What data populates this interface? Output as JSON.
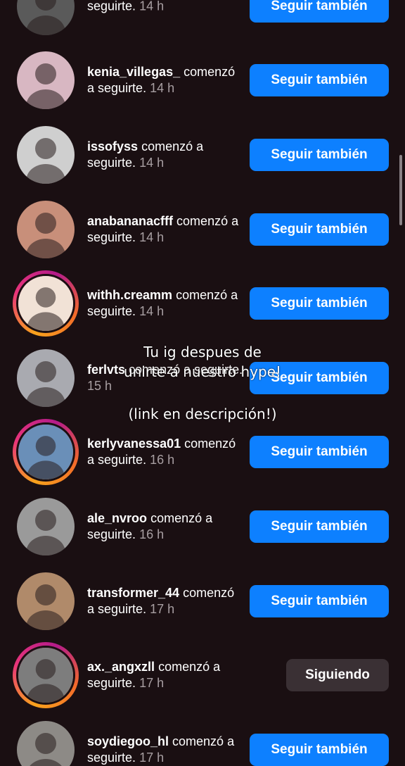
{
  "followers": [
    {
      "username": "",
      "action_line1": "",
      "action_line2": "seguirte.",
      "time": "14 h",
      "button": "Seguir también",
      "following": false,
      "ring": false,
      "avatar_color": "#5a5a5a"
    },
    {
      "username": "kenia_villegas_",
      "action_line1": "comenzó a",
      "action_line2": "seguirte.",
      "time": "14 h",
      "button": "Seguir también",
      "following": false,
      "ring": false,
      "avatar_color": "#d8b7c2"
    },
    {
      "username": "issofyss",
      "action_line1": "comenzó a",
      "action_line2": "seguirte.",
      "time": "14 h",
      "button": "Seguir también",
      "following": false,
      "ring": false,
      "avatar_color": "#cfcfcf"
    },
    {
      "username": "anabananacfff",
      "action_line1": "comenzó a",
      "action_line2": "seguirte.",
      "time": "14 h",
      "button": "Seguir también",
      "following": false,
      "ring": false,
      "avatar_color": "#c88f7a"
    },
    {
      "username": "withh.creamm",
      "action_line1": "comenzó a",
      "action_line2": "seguirte.",
      "time": "14 h",
      "button": "Seguir también",
      "following": false,
      "ring": true,
      "avatar_color": "#f1e2d6"
    },
    {
      "username": "ferlvts",
      "action_line1": "comenzó a",
      "action_line2": "seguirte.",
      "time": "15 h",
      "button": "Seguir también",
      "following": false,
      "ring": false,
      "avatar_color": "#a9aab0"
    },
    {
      "username": "kerlyvanessa01",
      "action_line1": "comenzó a",
      "action_line2": "seguirte.",
      "time": "16 h",
      "button": "Seguir también",
      "following": false,
      "ring": true,
      "avatar_color": "#6a8fb8"
    },
    {
      "username": "ale_nvroo",
      "action_line1": "comenzó a",
      "action_line2": "seguirte.",
      "time": "16 h",
      "button": "Seguir también",
      "following": false,
      "ring": false,
      "avatar_color": "#9a9a9a"
    },
    {
      "username": "transformer_44",
      "action_line1": "comenzó a",
      "action_line2": "seguirte.",
      "time": "17 h",
      "button": "Seguir también",
      "following": false,
      "ring": false,
      "avatar_color": "#b08a6a"
    },
    {
      "username": "ax._angxzll",
      "action_line1": "comenzó a",
      "action_line2": "seguirte.",
      "time": "17 h",
      "button": "Siguiendo",
      "following": true,
      "ring": true,
      "avatar_color": "#7d7d7d"
    },
    {
      "username": "soydiegoo_hl",
      "action_line1": "comenzó a",
      "action_line2": "seguirte.",
      "time": "17 h",
      "button": "Seguir también",
      "following": false,
      "ring": false,
      "avatar_color": "#8d8a86"
    }
  ],
  "overlay": {
    "line1": "Tu ig despues de",
    "line2": "unirte a nuestro hype!",
    "line3": "(link en descripción!)"
  }
}
